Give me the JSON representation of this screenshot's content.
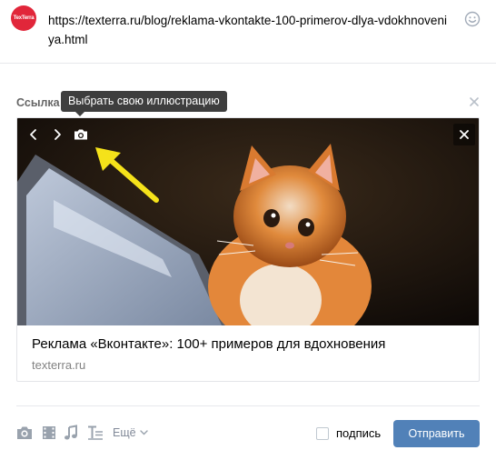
{
  "composer": {
    "avatar_text": "TexTerra",
    "post_text": "https://texterra.ru/blog/reklama-vkontakte-100-primerov-dlya-vdokhnoveniya.html",
    "smile_icon": "smile-icon"
  },
  "link_section": {
    "label": "Ссылка",
    "tooltip": "Выбрать свою иллюстрацию",
    "card": {
      "title": "Реклама «Вконтакте»: 100+ примеров для вдохновения",
      "domain": "texterra.ru"
    }
  },
  "toolbar": {
    "icons": [
      "camera-icon",
      "video-icon",
      "music-icon",
      "text-format-icon"
    ],
    "more_label": "Ещё",
    "signature_label": "подпись",
    "send_label": "Отправить"
  },
  "colors": {
    "brand_blue": "#5181b8",
    "arrow_yellow": "#f5e21a",
    "tooltip_bg": "#3e3e3e",
    "avatar_red": "#e1263a"
  }
}
